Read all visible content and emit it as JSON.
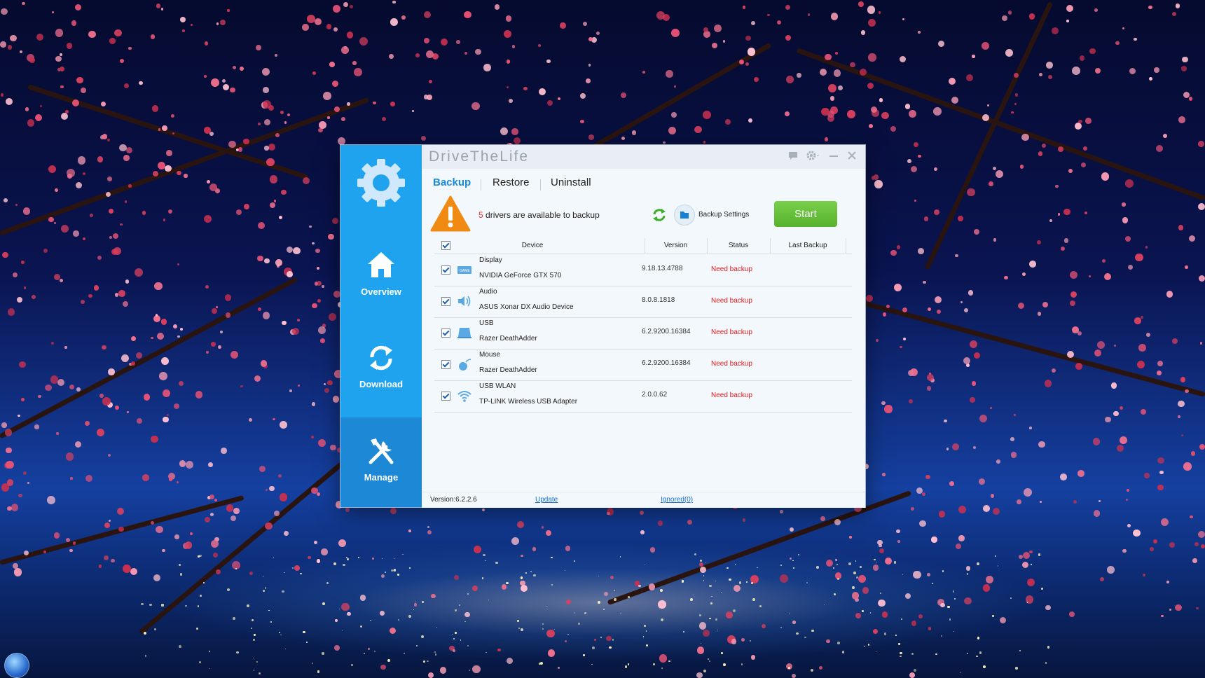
{
  "app": {
    "title": "DriveTheLife"
  },
  "sidebar": {
    "items": [
      {
        "label": "Overview",
        "icon": "home-icon"
      },
      {
        "label": "Download",
        "icon": "refresh-arrows-icon"
      },
      {
        "label": "Manage",
        "icon": "tools-icon",
        "active": true
      }
    ]
  },
  "tabs": [
    {
      "label": "Backup",
      "active": true
    },
    {
      "label": "Restore"
    },
    {
      "label": "Uninstall"
    }
  ],
  "info": {
    "count": "5",
    "text": " drivers are available to backup"
  },
  "toolbar": {
    "backup_settings_label": "Backup Settings",
    "start_label": "Start"
  },
  "table": {
    "headers": [
      "Device",
      "Version",
      "Status",
      "Last Backup"
    ],
    "rows": [
      {
        "category": "Display",
        "name": "NVIDIA GeForce GTX 570",
        "version": "9.18.13.4788",
        "status": "Need backup",
        "icon": "display-card-icon"
      },
      {
        "category": "Audio",
        "name": "ASUS Xonar DX Audio Device",
        "version": "8.0.8.1818",
        "status": "Need backup",
        "icon": "speaker-icon"
      },
      {
        "category": "USB",
        "name": "Razer DeathAdder",
        "version": "6.2.9200.16384",
        "status": "Need backup",
        "icon": "usb-icon"
      },
      {
        "category": "Mouse",
        "name": "Razer DeathAdder",
        "version": "6.2.9200.16384",
        "status": "Need backup",
        "icon": "mouse-icon"
      },
      {
        "category": "USB WLAN",
        "name": "TP-LINK Wireless USB Adapter",
        "version": "2.0.0.62",
        "status": "Need backup",
        "icon": "wifi-icon"
      }
    ]
  },
  "footer": {
    "version": "Version:6.2.2.6",
    "update_label": "Update",
    "ignored_label": "Ignored(0)"
  },
  "colors": {
    "sidebar": "#1fa3ee",
    "sidebar_active": "#1c88d6",
    "accent": "#1a8ad8",
    "start_button": "#5fb934",
    "status_red": "#e21c1c",
    "warning_orange": "#f08a12"
  }
}
